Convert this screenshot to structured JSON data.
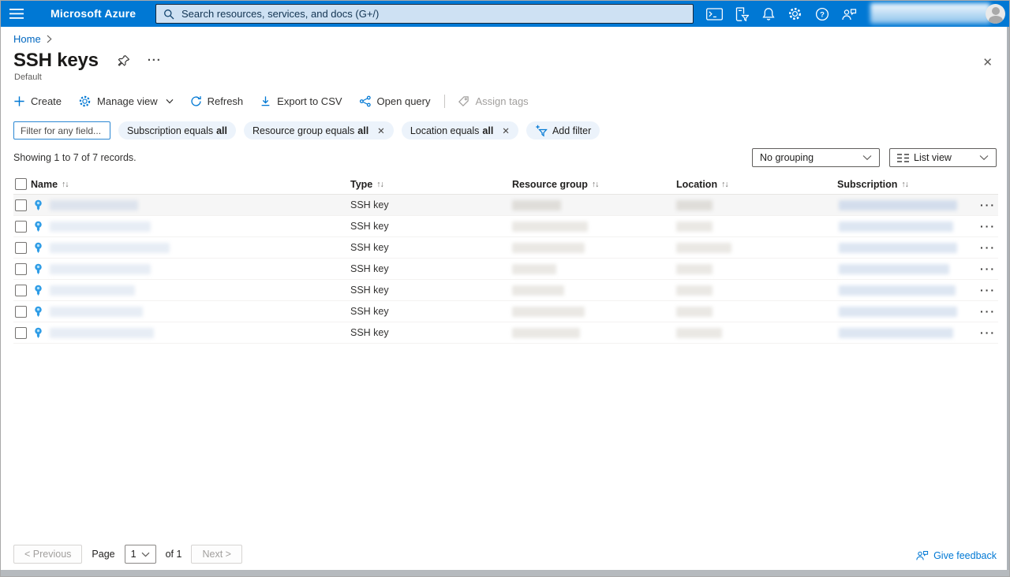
{
  "topbar": {
    "brand": "Microsoft Azure",
    "search_placeholder": "Search resources, services, and docs (G+/)",
    "icons": [
      "cloud-shell-icon",
      "directory-filter-icon",
      "notifications-icon",
      "settings-icon",
      "help-icon",
      "feedback-icon"
    ]
  },
  "breadcrumb": {
    "home": "Home"
  },
  "page": {
    "title": "SSH keys",
    "subtitle": "Default"
  },
  "toolbar": {
    "create": "Create",
    "manage_view": "Manage view",
    "refresh": "Refresh",
    "export_csv": "Export to CSV",
    "open_query": "Open query",
    "assign_tags": "Assign tags"
  },
  "filters": {
    "input_placeholder": "Filter for any field...",
    "pills": [
      {
        "label": "Subscription equals",
        "value": "all"
      },
      {
        "label": "Resource group equals",
        "value": "all"
      },
      {
        "label": "Location equals",
        "value": "all"
      }
    ],
    "add_filter": "Add filter"
  },
  "status": {
    "showing": "Showing 1 to 7 of 7 records.",
    "grouping": "No grouping",
    "view": "List view"
  },
  "table": {
    "columns": [
      "Name",
      "Type",
      "Resource group",
      "Location",
      "Subscription"
    ],
    "rows": [
      {
        "type": "SSH key"
      },
      {
        "type": "SSH key"
      },
      {
        "type": "SSH key"
      },
      {
        "type": "SSH key"
      },
      {
        "type": "SSH key"
      },
      {
        "type": "SSH key"
      },
      {
        "type": "SSH key"
      }
    ]
  },
  "pagination": {
    "previous": "< Previous",
    "page_label": "Page",
    "page_value": "1",
    "of_label": "of 1",
    "next": "Next >"
  },
  "footer": {
    "feedback": "Give feedback"
  },
  "colors": {
    "accent": "#0078d4",
    "topbar": "#0078d4"
  }
}
